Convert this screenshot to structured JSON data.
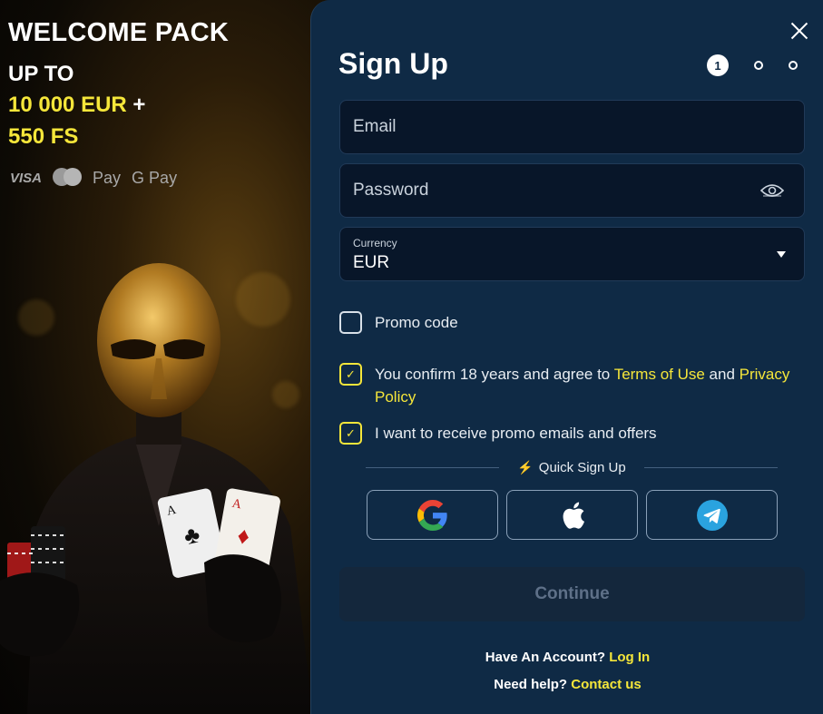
{
  "promo": {
    "title": "WELCOME PACK",
    "up_to": "UP TO",
    "amount": "10 000 EUR",
    "plus": " +",
    "free_spins": "550 FS",
    "payments": {
      "visa": "VISA",
      "apple_pay": "Pay",
      "google_pay": "G Pay"
    }
  },
  "form": {
    "title": "Sign Up",
    "steps": {
      "active": "1"
    },
    "email": {
      "placeholder": "Email"
    },
    "password": {
      "placeholder": "Password"
    },
    "currency": {
      "label": "Currency",
      "value": "EUR"
    },
    "promo_code": {
      "label": "Promo code",
      "checked": false
    },
    "terms": {
      "prefix": "You confirm 18 years and agree to ",
      "terms_link": "Terms of Use",
      "middle": " and ",
      "privacy_link": "Privacy Policy",
      "checked": true
    },
    "promo_emails": {
      "label": "I want to receive promo emails and offers",
      "checked": true
    },
    "quick_signup": "Quick Sign Up",
    "social": [
      "google-icon",
      "apple-icon",
      "telegram-icon"
    ],
    "continue_label": "Continue",
    "have_account": "Have An Account? ",
    "login_link": "Log In",
    "need_help": "Need help? ",
    "contact_link": "Contact us"
  },
  "colors": {
    "accent": "#f5e63a",
    "panel_bg": "#0f2a45",
    "field_bg": "#081629"
  }
}
